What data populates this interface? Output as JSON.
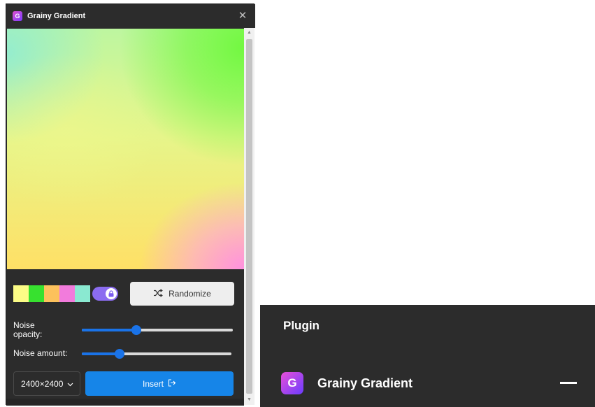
{
  "plugin_window": {
    "title": "Grainy Gradient",
    "icon_letter": "G",
    "close_glyph": "✕",
    "swatch_colors": [
      "#fcfc86",
      "#37e12f",
      "#fcc15c",
      "#f27bdc",
      "#8ae9d1"
    ],
    "lock_toggle_color": "#8b6cf0",
    "randomize_label": "Randomize",
    "noise_opacity_label_line1": "Noise",
    "noise_opacity_label_line2": "opacity:",
    "noise_opacity_value": 0.36,
    "noise_amount_label": "Noise amount:",
    "noise_amount_value": 0.25,
    "size_value": "2400×2400",
    "insert_label": "Insert",
    "accent_color": "#1685e8"
  },
  "plugins_panel": {
    "heading": "Plugin",
    "plugin_name": "Grainy Gradient",
    "icon_letter": "G"
  },
  "icons": [
    "app-icon",
    "close-icon",
    "lock-icon",
    "shuffle-icon",
    "chevron-down-icon",
    "insert-icon",
    "minimize-icon"
  ]
}
